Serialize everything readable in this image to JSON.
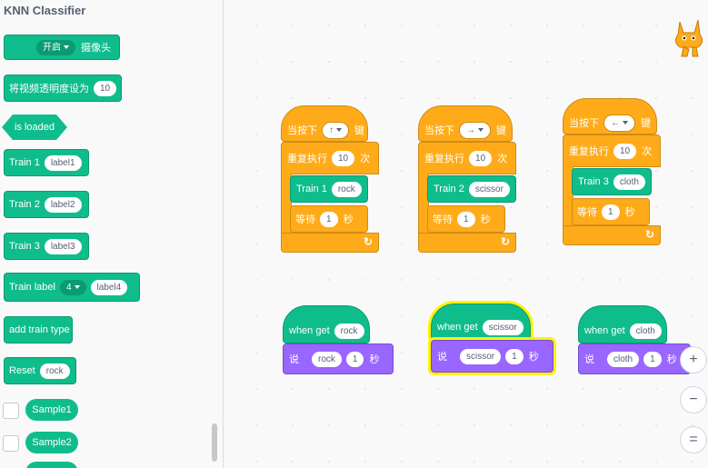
{
  "palette": {
    "title": "KNN Classifier",
    "blocks": {
      "open_camera": {
        "dropdown": "开启",
        "text": "摄像头"
      },
      "video_transparency": {
        "text": "将视频透明度设为",
        "value": "10"
      },
      "is_loaded": "is loaded",
      "train1": {
        "text": "Train 1",
        "value": "label1"
      },
      "train2": {
        "text": "Train 2",
        "value": "label2"
      },
      "train3": {
        "text": "Train 3",
        "value": "label3"
      },
      "train_label": {
        "text": "Train label",
        "dropdown": "4",
        "value": "label4"
      },
      "add_train_type": "add train type",
      "reset": {
        "text": "Reset",
        "value": "rock"
      },
      "sample1": "Sample1",
      "sample2": "Sample2"
    }
  },
  "scripts": [
    {
      "when_key": "当按下",
      "key": "↑",
      "key_suffix": "键",
      "repeat": "重复执行",
      "times": "10",
      "times_suffix": "次",
      "train": "Train 1",
      "label": "rock",
      "wait": "等待",
      "seconds": "1",
      "seconds_suffix": "秒"
    },
    {
      "when_key": "当按下",
      "key": "→",
      "key_suffix": "键",
      "repeat": "重复执行",
      "times": "10",
      "times_suffix": "次",
      "train": "Train 2",
      "label": "scissor",
      "wait": "等待",
      "seconds": "1",
      "seconds_suffix": "秒"
    },
    {
      "when_key": "当按下",
      "key": "←",
      "key_suffix": "键",
      "repeat": "重复执行",
      "times": "10",
      "times_suffix": "次",
      "train": "Train 3",
      "label": "cloth",
      "wait": "等待",
      "seconds": "1",
      "seconds_suffix": "秒"
    }
  ],
  "events": [
    {
      "when_get": "when get",
      "label": "rock",
      "say": "说",
      "say_value": "rock",
      "say_secs": "1",
      "say_suffix": "秒"
    },
    {
      "when_get": "when get",
      "label": "scissor",
      "say": "说",
      "say_value": "scissor",
      "say_secs": "1",
      "say_suffix": "秒"
    },
    {
      "when_get": "when get",
      "label": "cloth",
      "say": "说",
      "say_value": "cloth",
      "say_secs": "1",
      "say_suffix": "秒"
    }
  ],
  "zoom": {
    "in": "+",
    "out": "−",
    "reset": "="
  },
  "colors": {
    "extension": "#0fbd8c",
    "control": "#ffab19",
    "looks": "#9966ff",
    "highlight": "#fff200"
  }
}
